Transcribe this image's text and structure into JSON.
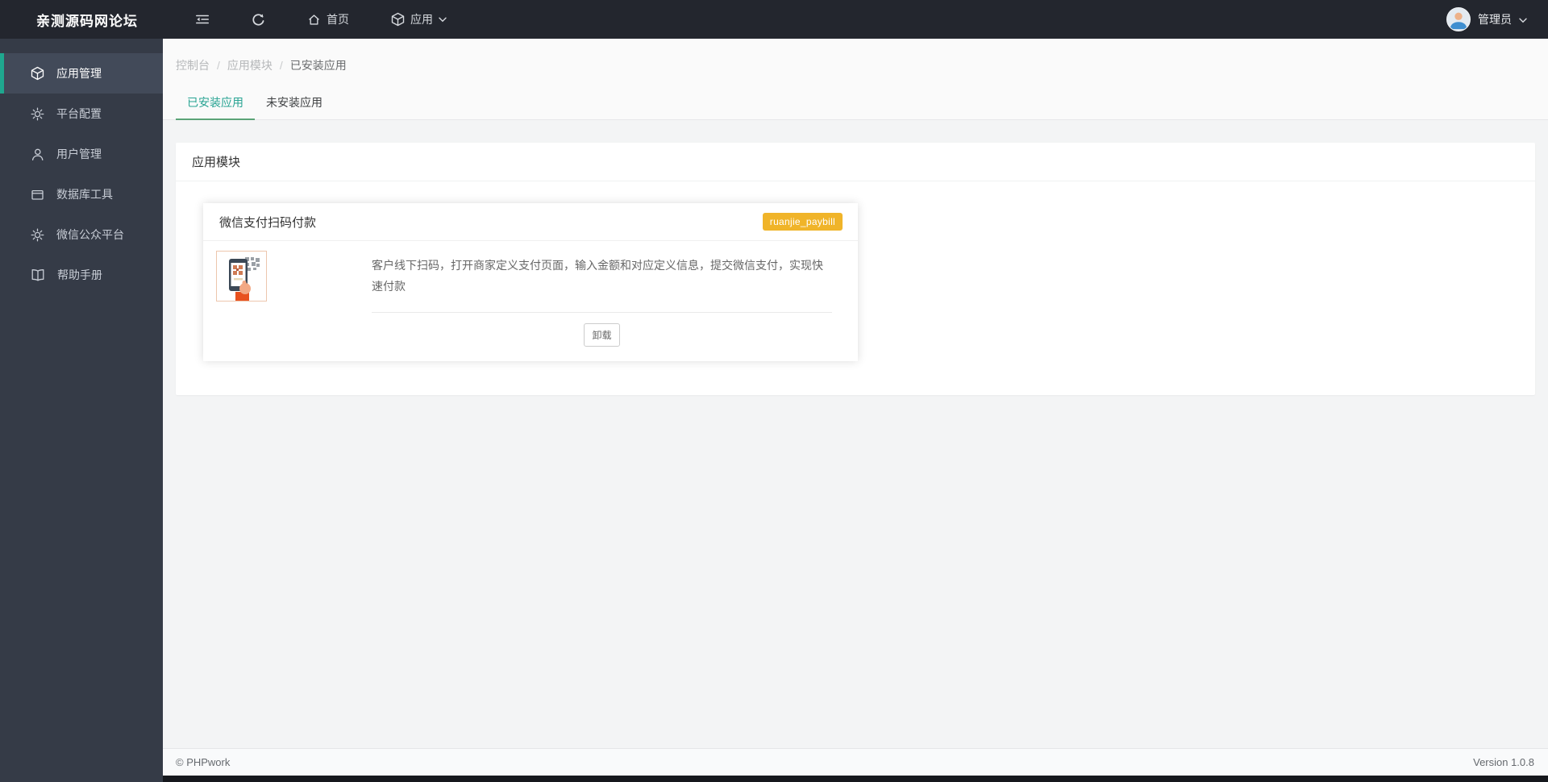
{
  "topbar": {
    "brand": "亲测源码网论坛",
    "nav": {
      "home_label": "首页",
      "app_label": "应用"
    },
    "user": {
      "name": "管理员"
    }
  },
  "sidebar": {
    "items": [
      {
        "icon": "cube-icon",
        "label": "应用管理",
        "active": true
      },
      {
        "icon": "gear-icon",
        "label": "平台配置",
        "active": false
      },
      {
        "icon": "user-icon",
        "label": "用户管理",
        "active": false
      },
      {
        "icon": "window-icon",
        "label": "数据库工具",
        "active": false
      },
      {
        "icon": "gear-icon",
        "label": "微信公众平台",
        "active": false
      },
      {
        "icon": "book-icon",
        "label": "帮助手册",
        "active": false
      }
    ]
  },
  "breadcrumb": {
    "separator": "/",
    "items": [
      "控制台",
      "应用模块",
      "已安装应用"
    ]
  },
  "tabs": [
    {
      "label": "已安装应用",
      "active": true
    },
    {
      "label": "未安装应用",
      "active": false
    }
  ],
  "panel": {
    "title": "应用模块"
  },
  "app_card": {
    "title": "微信支付扫码付款",
    "badge": "ruanjie_paybill",
    "description": "客户线下扫码，打开商家定义支付页面，输入金额和对应定义信息，提交微信支付，实现快速付款",
    "uninstall_label": "卸载"
  },
  "footer": {
    "copyright": "© PHPwork",
    "version": "Version 1.0.8"
  },
  "colors": {
    "topbar_bg": "#23262e",
    "sidebar_bg": "#353b47",
    "sidebar_active_bg": "#424a59",
    "accent_teal": "#1fa78f",
    "tab_active_text": "#27a392",
    "tab_underline": "#5ba477",
    "badge_bg": "#f0b429",
    "page_bg": "#f3f4f5",
    "panel_bg": "#ffffff"
  }
}
